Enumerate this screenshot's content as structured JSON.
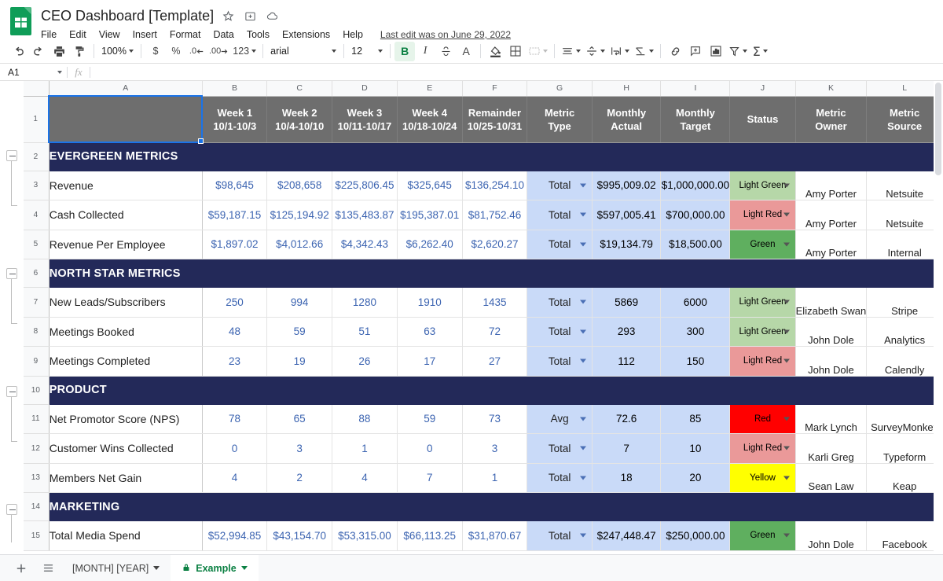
{
  "titlebar": {
    "doc_title": "CEO Dashboard [Template]",
    "star_icon": "star-icon",
    "move_icon": "move-to-folder-icon",
    "cloud_icon": "cloud-saved-icon",
    "menus": [
      "File",
      "Edit",
      "View",
      "Insert",
      "Format",
      "Data",
      "Tools",
      "Extensions",
      "Help"
    ],
    "last_edit": "Last edit was on June 29, 2022"
  },
  "toolbar": {
    "undo": "undo-icon",
    "redo": "redo-icon",
    "print": "print-icon",
    "paint": "paint-format-icon",
    "zoom": "100%",
    "currency": "$",
    "percent": "%",
    "decrease_decimal": ".0",
    "increase_decimal": ".00",
    "more_formats": "123",
    "font": "arial",
    "font_size": "12",
    "bold": "B",
    "italic": "I",
    "strikethrough": "S",
    "text_color": "A",
    "fill_color": "fill-color-icon",
    "borders": "borders-icon",
    "merge_cells": "merge-cells-icon",
    "halign": "horizontal-align-icon",
    "valign": "vertical-align-icon",
    "text_wrap": "text-wrap-icon",
    "text_rotation": "text-rotation-icon",
    "link": "insert-link-icon",
    "comment": "insert-comment-icon",
    "chart": "insert-chart-icon",
    "filter": "filter-icon",
    "functions": "functions-icon"
  },
  "formulabar": {
    "name_box": "A1",
    "fx": "fx",
    "value": ""
  },
  "grid": {
    "columns": [
      "A",
      "B",
      "C",
      "D",
      "E",
      "F",
      "G",
      "H",
      "I",
      "J",
      "K",
      "L"
    ],
    "header_row": {
      "row_number": "1",
      "A": "",
      "cells": [
        {
          "line1": "Week 1",
          "line2": "10/1-10/3"
        },
        {
          "line1": "Week 2",
          "line2": "10/4-10/10"
        },
        {
          "line1": "Week 3",
          "line2": "10/11-10/17"
        },
        {
          "line1": "Week 4",
          "line2": "10/18-10/24"
        },
        {
          "line1": "Remainder",
          "line2": "10/25-10/31"
        },
        {
          "line1": "Metric",
          "line2": "Type"
        },
        {
          "line1": "Monthly",
          "line2": "Actual"
        },
        {
          "line1": "Monthly",
          "line2": "Target"
        },
        {
          "line1": "Status",
          "line2": ""
        },
        {
          "line1": "Metric",
          "line2": "Owner"
        },
        {
          "line1": "Metric",
          "line2": "Source"
        }
      ]
    },
    "rows": [
      {
        "n": "2",
        "type": "section",
        "label": "EVERGREEN METRICS"
      },
      {
        "n": "3",
        "type": "data",
        "name": "Revenue",
        "weeks": [
          "$98,645",
          "$208,658",
          "$225,806.45",
          "$325,645",
          "$136,254.10"
        ],
        "metric_type": "Total",
        "actual": "$995,009.02",
        "target": "$1,000,000.00",
        "status": "Light Green",
        "status_color": "#b6d7a8",
        "owner": "Amy Porter",
        "source": "Netsuite"
      },
      {
        "n": "4",
        "type": "data",
        "name": "Cash Collected",
        "weeks": [
          "$59,187.15",
          "$125,194.92",
          "$135,483.87",
          "$195,387.01",
          "$81,752.46"
        ],
        "metric_type": "Total",
        "actual": "$597,005.41",
        "target": "$700,000.00",
        "status": "Light Red",
        "status_color": "#ea9999",
        "owner": "Amy Porter",
        "source": "Netsuite"
      },
      {
        "n": "5",
        "type": "data",
        "name": "Revenue Per Employee",
        "weeks": [
          "$1,897.02",
          "$4,012.66",
          "$4,342.43",
          "$6,262.40",
          "$2,620.27"
        ],
        "metric_type": "Total",
        "actual": "$19,134.79",
        "target": "$18,500.00",
        "status": "Green",
        "status_color": "#5faf5f",
        "owner": "Amy Porter",
        "source": "Internal"
      },
      {
        "n": "6",
        "type": "section",
        "label": "NORTH STAR METRICS"
      },
      {
        "n": "7",
        "type": "data",
        "name": "New Leads/Subscribers",
        "weeks": [
          "250",
          "994",
          "1280",
          "1910",
          "1435"
        ],
        "metric_type": "Total",
        "actual": "5869",
        "target": "6000",
        "status": "Light Green",
        "status_color": "#b6d7a8",
        "owner": "Elizabeth Swan",
        "source": "Stripe"
      },
      {
        "n": "8",
        "type": "data",
        "name": "Meetings Booked",
        "weeks": [
          "48",
          "59",
          "51",
          "63",
          "72"
        ],
        "metric_type": "Total",
        "actual": "293",
        "target": "300",
        "status": "Light Green",
        "status_color": "#b6d7a8",
        "owner": "John Dole",
        "source": "Analytics"
      },
      {
        "n": "9",
        "type": "data",
        "name": "Meetings Completed",
        "weeks": [
          "23",
          "19",
          "26",
          "17",
          "27"
        ],
        "metric_type": "Total",
        "actual": "112",
        "target": "150",
        "status": "Light Red",
        "status_color": "#ea9999",
        "owner": "John Dole",
        "source": "Calendly"
      },
      {
        "n": "10",
        "type": "section",
        "label": "PRODUCT"
      },
      {
        "n": "11",
        "type": "data",
        "name": "Net Promotor Score (NPS)",
        "weeks": [
          "78",
          "65",
          "88",
          "59",
          "73"
        ],
        "metric_type": "Avg",
        "actual": "72.6",
        "target": "85",
        "status": "Red",
        "status_color": "#ff0000",
        "owner": "Mark Lynch",
        "source": "SurveyMonkey"
      },
      {
        "n": "12",
        "type": "data",
        "name": "Customer Wins Collected",
        "weeks": [
          "0",
          "3",
          "1",
          "0",
          "3"
        ],
        "metric_type": "Total",
        "actual": "7",
        "target": "10",
        "status": "Light Red",
        "status_color": "#ea9999",
        "owner": "Karli Greg",
        "source": "Typeform"
      },
      {
        "n": "13",
        "type": "data",
        "name": "Members Net Gain",
        "weeks": [
          "4",
          "2",
          "4",
          "7",
          "1"
        ],
        "metric_type": "Total",
        "actual": "18",
        "target": "20",
        "status": "Yellow",
        "status_color": "#ffff00",
        "owner": "Sean Law",
        "source": "Keap"
      },
      {
        "n": "14",
        "type": "section",
        "label": "MARKETING"
      },
      {
        "n": "15",
        "type": "data",
        "name": "Total Media Spend",
        "weeks": [
          "$52,994.85",
          "$43,154.70",
          "$53,315.00",
          "$66,113.25",
          "$31,870.67"
        ],
        "metric_type": "Total",
        "actual": "$247,448.47",
        "target": "$250,000.00",
        "status": "Green",
        "status_color": "#5faf5f",
        "owner": "John Dole",
        "source": "Facebook"
      }
    ]
  },
  "bottombar": {
    "add_sheet": "add-sheet-icon",
    "all_sheets": "all-sheets-icon",
    "tabs": [
      {
        "label": "[MONTH] [YEAR]",
        "active": false,
        "locked": false
      },
      {
        "label": "Example",
        "active": true,
        "locked": true
      }
    ]
  },
  "colors": {
    "section_navy": "#232959",
    "header_gray": "#6e6e6e",
    "accent_blue": "#1a73e8",
    "week_text": "#3c64b1",
    "cell_blue": "#c9daf8",
    "sheets_green": "#0f9d58"
  }
}
